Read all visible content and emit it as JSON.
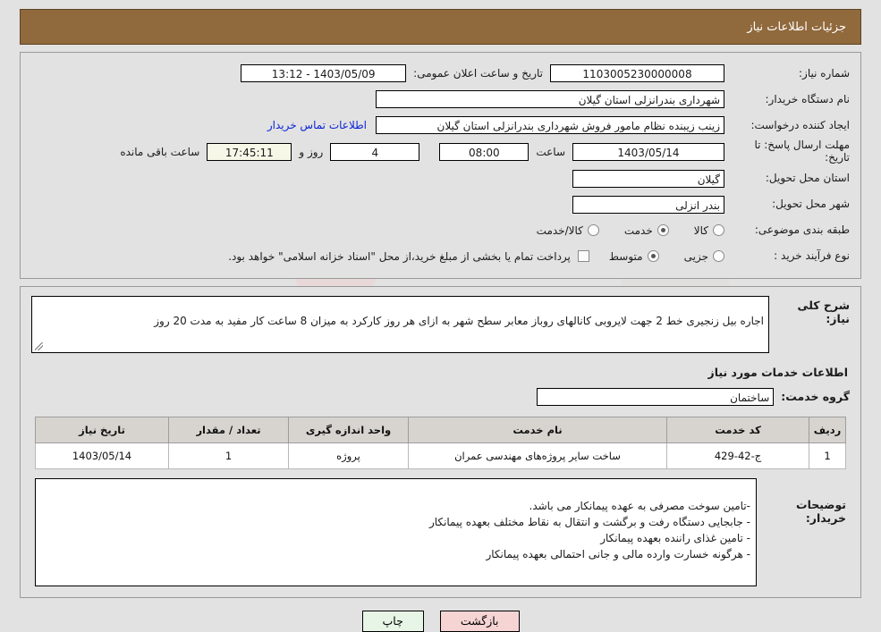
{
  "header": {
    "title": "جزئیات اطلاعات نیاز"
  },
  "watermark": {
    "text": "AriaTender.net"
  },
  "top": {
    "need_number_label": "شماره نیاز:",
    "need_number_value": "1103005230000008",
    "publish_label": "تاریخ و ساعت اعلان عمومی:",
    "publish_value": "1403/05/09 - 13:12",
    "buyer_org_label": "نام دستگاه خریدار:",
    "buyer_org_value": "شهرداری بندرانزلی استان گیلان",
    "creator_label": "ایجاد کننده درخواست:",
    "creator_value": "زینب زیبنده نظام مامور فروش شهرداری بندرانزلی استان گیلان",
    "contact_link": "اطلاعات تماس خریدار",
    "deadline_label": "مهلت ارسال پاسخ: تا تاریخ:",
    "deadline_date": "1403/05/14",
    "hour_label": "ساعت",
    "deadline_time": "08:00",
    "days_value": "4",
    "days_label": "روز و",
    "remaining_time": "17:45:11",
    "remaining_label": "ساعت باقی مانده",
    "province_label": "استان محل تحویل:",
    "province_value": "گیلان",
    "city_label": "شهر محل تحویل:",
    "city_value": "بندر انزلی",
    "category_label": "طبقه بندی موضوعی:",
    "category_options": [
      "کالا",
      "خدمت",
      "کالا/خدمت"
    ],
    "category_selected": "خدمت",
    "process_label": "نوع فرآیند خرید :",
    "process_options": [
      "جزیی",
      "متوسط"
    ],
    "process_selected": "متوسط",
    "treasury_checked": false,
    "treasury_note": "پرداخت تمام یا بخشی از مبلغ خرید،از محل \"اسناد خزانه اسلامی\" خواهد بود."
  },
  "middle": {
    "desc_label": "شرح کلی نیاز:",
    "desc_value": "اجاره بیل زنجیری خط 2 جهت لایروبی کانالهای روباز معابر سطح شهر به ازای هر روز کارکرد به میزان 8 ساعت کار مفید به مدت 20 روز",
    "services_head": "اطلاعات خدمات مورد نیاز",
    "service_group_label": "گروه خدمت:",
    "service_group_value": "ساختمان"
  },
  "table": {
    "columns": [
      "ردیف",
      "کد خدمت",
      "نام خدمت",
      "واحد اندازه گیری",
      "تعداد / مقدار",
      "تاریخ نیاز"
    ],
    "rows": [
      {
        "radif": "1",
        "code": "ج-42-429",
        "name": "ساخت سایر پروژه‌های مهندسی عمران",
        "unit": "پروژه",
        "qty": "1",
        "date": "1403/05/14"
      }
    ]
  },
  "notes": {
    "label": "توضیحات خریدار:",
    "value": "-تامین سوخت مصرفی به عهده پیمانکار می باشد.\n- جابجایی دستگاه رفت و برگشت و انتقال به نقاط مختلف بعهده پیمانکار\n- تامین غذای راننده بعهده پیمانکار\n- هرگونه خسارت وارده مالی و جانی احتمالی بعهده پیمانکار"
  },
  "footer": {
    "print_label": "چاپ",
    "back_label": "بازگشت"
  }
}
